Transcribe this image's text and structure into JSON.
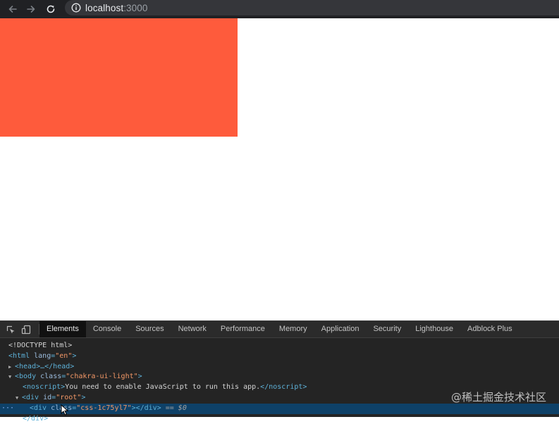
{
  "browser": {
    "url_host": "localhost",
    "url_port": ":3000",
    "icons": [
      "back-arrow-icon",
      "forward-arrow-icon",
      "reload-icon",
      "info-icon"
    ]
  },
  "page": {
    "box_color": "#fe5b3c"
  },
  "devtools": {
    "tabs": [
      {
        "label": "Elements",
        "active": true
      },
      {
        "label": "Console"
      },
      {
        "label": "Sources"
      },
      {
        "label": "Network"
      },
      {
        "label": "Performance"
      },
      {
        "label": "Memory"
      },
      {
        "label": "Application"
      },
      {
        "label": "Security"
      },
      {
        "label": "Lighthouse"
      },
      {
        "label": "Adblock Plus"
      }
    ],
    "dom": {
      "doctype": "<!DOCTYPE html>",
      "html_open": "<html",
      "html_attr": "lang",
      "html_val": "\"en\"",
      "html_close": ">",
      "head": "<head>…</head>",
      "body_open": "<body",
      "body_attr": "class",
      "body_val": "\"chakra-ui-light\"",
      "body_close": ">",
      "noscript_open": "<noscript>",
      "noscript_text": "You need to enable JavaScript to run this app.",
      "noscript_close": "</noscript>",
      "div_root_open": "<div",
      "div_root_attr": "id",
      "div_root_val": "\"root\"",
      "div_root_close": ">",
      "div_sel_open": "<div",
      "div_sel_attr": "class",
      "div_sel_val": "\"css-1c75yl7\"",
      "div_sel_close": "></div>",
      "div_sel_ref": "== $0",
      "div_end": "</div>",
      "dots": "···"
    }
  },
  "watermark": "@稀土掘金技术社区"
}
